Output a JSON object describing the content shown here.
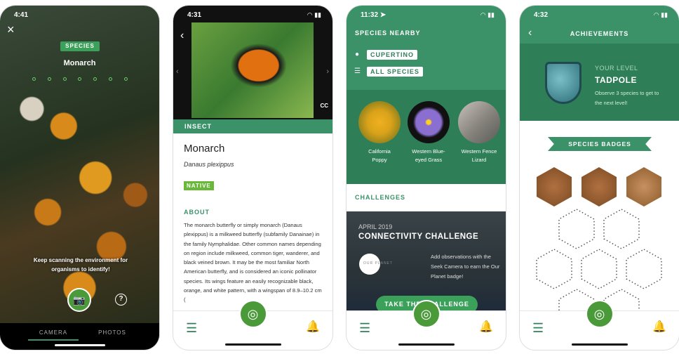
{
  "screen1": {
    "status_time": "4:41",
    "close": "×",
    "badge": "SPECIES",
    "species": "Monarch",
    "hint": "Keep scanning the environment for organisms to identify!",
    "help": "?",
    "tabs": [
      {
        "label": "CAMERA",
        "active": true
      },
      {
        "label": "PHOTOS",
        "active": false
      }
    ]
  },
  "screen2": {
    "status_time": "4:31",
    "cc": "CC",
    "category": "INSECT",
    "title": "Monarch",
    "scientific": "Danaus plexippus",
    "native": "NATIVE",
    "about_heading": "ABOUT",
    "about_text": "The monarch butterfly or simply monarch (Danaus plexippus) is a milkweed butterfly (subfamily Danainae) in the family Nymphalidae. Other common names depending on region include milkweed, common tiger, wanderer, and black veined brown. It may be the most familiar North American butterfly, and is considered an iconic pollinator species. Its wings feature an easily recognizable black, orange, and white pattern, with a wingspan of 8.9–10.2 cm ("
  },
  "screen3": {
    "status_time": "11:32 ➤",
    "heading": "SPECIES NEARBY",
    "location": "CUPERTINO",
    "filter": "ALL SPECIES",
    "species": [
      {
        "name": "California Poppy",
        "color": "#d9a21a"
      },
      {
        "name": "Western Blue-eyed Grass",
        "color": "#8a6fd0"
      },
      {
        "name": "Western Fence Lizard",
        "color": "#9a9a94"
      }
    ],
    "challenges_heading": "CHALLENGES",
    "challenge": {
      "date": "APRIL 2019",
      "title": "CONNECTIVITY CHALLENGE",
      "logo": "OUR PLANET",
      "description": "Add observations with the Seek Camera to earn the Our Planet badge!",
      "button": "TAKE THE CHALLENGE"
    }
  },
  "screen4": {
    "status_time": "4:32",
    "title": "ACHIEVEMENTS",
    "level_label": "YOUR LEVEL",
    "level": "TADPOLE",
    "level_hint": "Observe 3 species to get to the next level!",
    "badges_heading": "SPECIES BADGES"
  },
  "colors": {
    "primary": "#3b9168",
    "dark": "#2e7f58",
    "camera": "#4a9a3a"
  }
}
